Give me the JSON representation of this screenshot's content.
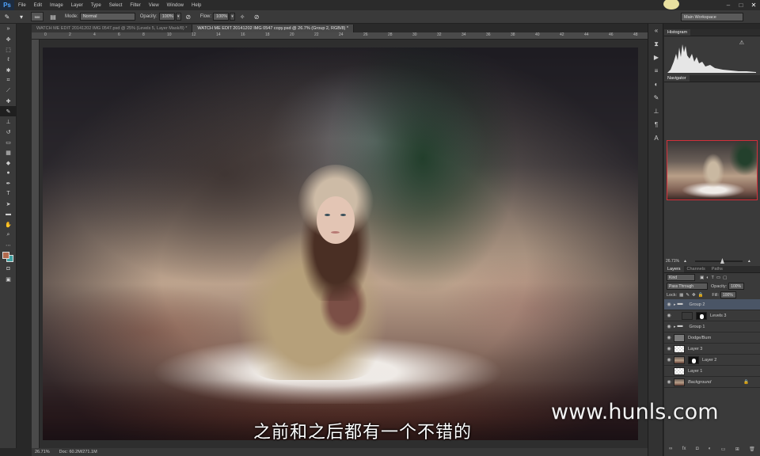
{
  "app": {
    "logo": "Ps"
  },
  "menu": [
    "File",
    "Edit",
    "Image",
    "Layer",
    "Type",
    "Select",
    "Filter",
    "View",
    "Window",
    "Help"
  ],
  "window_controls": [
    "–",
    "□",
    "✕"
  ],
  "options": {
    "brush_size": "500",
    "mode_label": "Mode:",
    "mode_value": "Normal",
    "opacity_label": "Opacity:",
    "opacity_value": "100%",
    "flow_label": "Flow:",
    "flow_value": "100%",
    "workspace": "Main Workspace"
  },
  "tabs": [
    {
      "label": "WATCH ME EDIT 20141202 IMG 0547.psd @ 25% (Levels 5, Layer Mask/8) *",
      "active": false
    },
    {
      "label": "WATCH ME EDIT 20141202 IMG 0547 copy.psd @ 26.7% (Group 2, RGB/8) *",
      "active": true
    }
  ],
  "ruler_ticks": [
    "0",
    "2",
    "4",
    "6",
    "8",
    "10",
    "12",
    "14",
    "16",
    "18",
    "20",
    "22",
    "24",
    "26",
    "28",
    "30",
    "32",
    "34",
    "36",
    "38",
    "40",
    "42",
    "44",
    "46",
    "48"
  ],
  "status": {
    "zoom": "26.71%",
    "doc": "Doc: 60.2M/271.1M"
  },
  "histogram": {
    "title": "Histogram",
    "warning": "⚠"
  },
  "navigator": {
    "title": "Navigator",
    "zoom": "26.71%"
  },
  "layers_panel": {
    "tabs": [
      "Layers",
      "Channels",
      "Paths"
    ],
    "kind": "Kind",
    "blend_mode": "Pass Through",
    "opacity_label": "Opacity:",
    "opacity_value": "100%",
    "lock_label": "Lock:",
    "fill_label": "Fill:",
    "fill_value": "100%",
    "layers": [
      {
        "name": "Group 2",
        "type": "folder",
        "selected": true
      },
      {
        "name": "Levels 3",
        "type": "adjust"
      },
      {
        "name": "Group 1",
        "type": "folder"
      },
      {
        "name": "Dodge/Burn",
        "type": "gray"
      },
      {
        "name": "Layer 3",
        "type": "checker"
      },
      {
        "name": "Layer 2",
        "type": "photo-mask"
      },
      {
        "name": "Layer 1",
        "type": "checker"
      },
      {
        "name": "Background",
        "type": "photo",
        "locked": true
      }
    ]
  },
  "subtitle": "之前和之后都有一个不错的",
  "watermark": "www.hunls.com"
}
